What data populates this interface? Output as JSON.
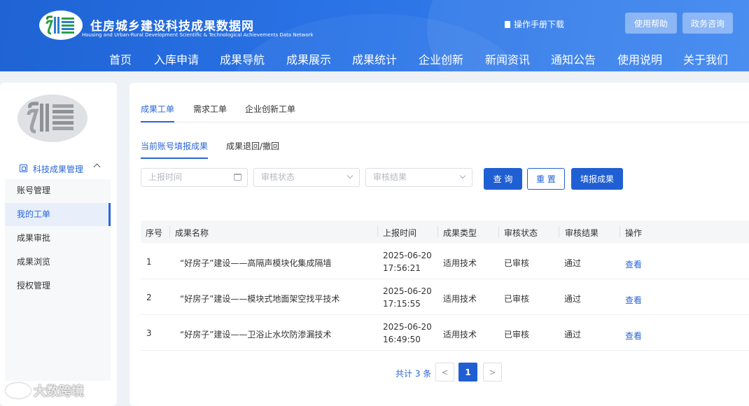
{
  "header": {
    "site_title": "住房城乡建设科技成果数据网",
    "site_subtitle": "Housing and Urban-Rural Development Scientific & Technological Achievements Data Network",
    "manual_label": "操作手册下载",
    "help_button": "使用帮助",
    "gov_button": "政务咨询",
    "nav": [
      "首页",
      "入库申请",
      "成果导航",
      "成果展示",
      "成果统计",
      "企业创新",
      "新闻资讯",
      "通知公告",
      "使用说明",
      "关于我们"
    ]
  },
  "sidebar": {
    "group_label": "科技成果管理",
    "items": [
      "账号管理",
      "我的工单",
      "成果审批",
      "成果浏览",
      "授权管理"
    ],
    "active_index": 1
  },
  "main": {
    "tabs": [
      "成果工单",
      "需求工单",
      "企业创新工单"
    ],
    "subtabs": [
      "当前账号填报成果",
      "成果退回/撤回"
    ],
    "filters": {
      "date_placeholder": "上报时间",
      "status_placeholder": "审核状态",
      "result_placeholder": "审核结果"
    },
    "buttons": {
      "query": "查 询",
      "reset": "重 置",
      "submit": "填报成果"
    },
    "table": {
      "headers": [
        "序号",
        "成果名称",
        "上报时间",
        "成果类型",
        "审核状态",
        "审核结果",
        "操作"
      ],
      "rows": [
        {
          "index": "1",
          "name": "“好房子”建设——高隔声模块化集成隔墙",
          "date": "2025-06-20",
          "time": "17:56:21",
          "type": "适用技术",
          "status": "已审核",
          "result": "通过",
          "action": "查看"
        },
        {
          "index": "2",
          "name": "“好房子”建设——模块式地面架空找平技术",
          "date": "2025-06-20",
          "time": "17:15:55",
          "type": "适用技术",
          "status": "已审核",
          "result": "通过",
          "action": "查看"
        },
        {
          "index": "3",
          "name": "“好房子”建设——卫浴止水坎防渗漏技术",
          "date": "2025-06-20",
          "time": "16:49:50",
          "type": "适用技术",
          "status": "已审核",
          "result": "通过",
          "action": "查看"
        }
      ]
    },
    "pager": {
      "total_text": "共计 3 条",
      "prev": "<",
      "current": "1",
      "next": ">"
    }
  },
  "watermark": "大数跨境",
  "colors": {
    "brand": "#1f5fd3",
    "link": "#2a66d8",
    "header_bg": "#2a73e6"
  }
}
